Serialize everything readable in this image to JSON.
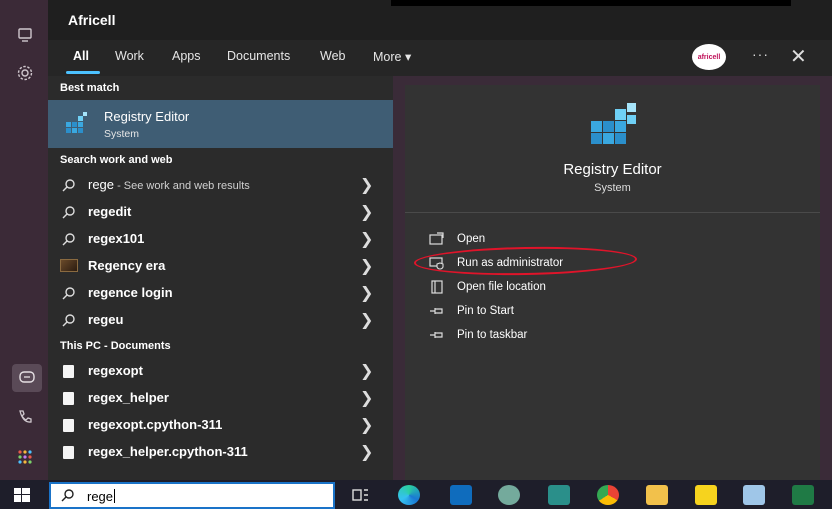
{
  "topbar": {
    "title": "Africell"
  },
  "tabs": [
    {
      "label": "All"
    },
    {
      "label": "Work"
    },
    {
      "label": "Apps"
    },
    {
      "label": "Documents"
    },
    {
      "label": "Web"
    },
    {
      "label": "More ▾"
    }
  ],
  "account": {
    "avatar_text": "africell"
  },
  "more_label": "···",
  "close_label": "✕",
  "best_match": {
    "heading": "Best match",
    "title": "Registry Editor",
    "subtitle": "System"
  },
  "web": {
    "heading": "Search work and web",
    "items": [
      {
        "label": "rege",
        "hint": " - See work and web results",
        "icon": "search-icon"
      },
      {
        "label": "regedit",
        "icon": "search-icon"
      },
      {
        "label": "regex101",
        "icon": "search-icon"
      },
      {
        "label": "Regency era",
        "icon": "thumbnail-image"
      },
      {
        "label": "regence login",
        "icon": "search-icon"
      },
      {
        "label": "regeu",
        "icon": "search-icon"
      }
    ]
  },
  "documents": {
    "heading": "This PC - Documents",
    "items": [
      {
        "label": "regexopt"
      },
      {
        "label": "regex_helper"
      },
      {
        "label": "regexopt.cpython-311"
      },
      {
        "label": "regex_helper.cpython-311"
      }
    ]
  },
  "preview": {
    "title": "Registry Editor",
    "subtitle": "System",
    "actions": [
      {
        "label": "Open",
        "icon": "open-icon"
      },
      {
        "label": "Run as administrator",
        "icon": "shield-icon"
      },
      {
        "label": "Open file location",
        "icon": "folder-location-icon"
      },
      {
        "label": "Pin to Start",
        "icon": "pin-icon"
      },
      {
        "label": "Pin to taskbar",
        "icon": "pin-icon"
      }
    ]
  },
  "search": {
    "value": "rege"
  },
  "colors": {
    "accent": "#4cc2ff",
    "selected": "#3f5d74",
    "annotation": "#e0142a"
  }
}
